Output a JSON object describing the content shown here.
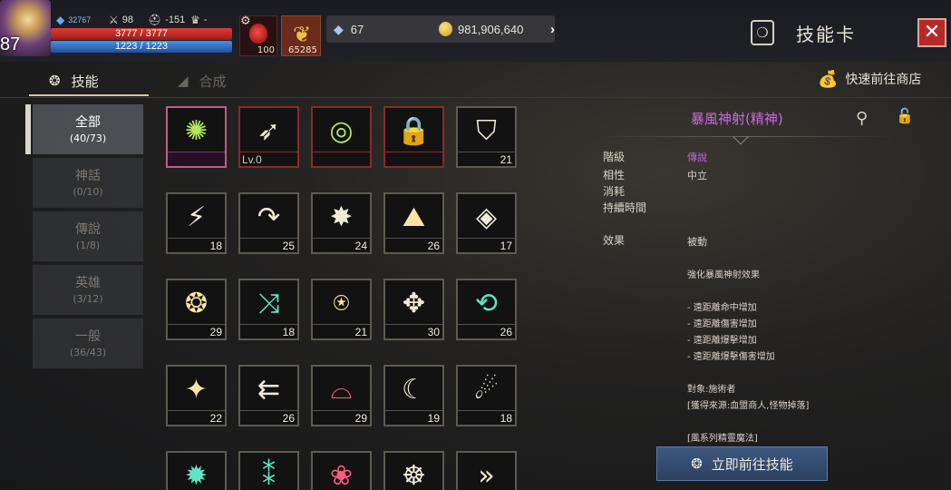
{
  "player": {
    "level": "87",
    "stats": [
      "32767",
      "98",
      "-151",
      "-"
    ],
    "hp_text": "3777 / 3777",
    "mp_text": "1223 / 1223"
  },
  "quick_items": {
    "potion_count": "100",
    "feather_count": "65285"
  },
  "currency": {
    "diamonds": "67",
    "gold": "981,906,640"
  },
  "header": {
    "panel_title": "技能卡"
  },
  "tabs": [
    {
      "label": "技能",
      "active": true
    },
    {
      "label": "合成",
      "active": false
    }
  ],
  "shop_link": "快速前往商店",
  "categories": [
    {
      "name": "全部",
      "count": "(40/73)",
      "active": true
    },
    {
      "name": "神話",
      "count": "(0/10)",
      "active": false
    },
    {
      "name": "傳說",
      "count": "(1/8)",
      "active": false
    },
    {
      "name": "英雄",
      "count": "(3/12)",
      "active": false
    },
    {
      "name": "一般",
      "count": "(36/43)",
      "active": false
    }
  ],
  "skill_grid": [
    {
      "icon": "nature-burst-icon",
      "glyph": "✺",
      "tone": "green",
      "frame": "sel",
      "level": ""
    },
    {
      "icon": "storm-arrow-icon",
      "glyph": "➶",
      "tone": "white",
      "frame": "red",
      "level": "Lv.0"
    },
    {
      "icon": "radar-tower-icon",
      "glyph": "◎",
      "tone": "green",
      "frame": "red",
      "level": ""
    },
    {
      "icon": "locked-star-icon",
      "glyph": "🔒",
      "tone": "white",
      "frame": "red",
      "level": ""
    },
    {
      "icon": "shield-crest-icon",
      "glyph": "⛉",
      "tone": "white",
      "frame": "normal",
      "level": "21"
    },
    {
      "icon": "lightning-bolt-icon",
      "glyph": "⚡",
      "tone": "white",
      "frame": "normal",
      "level": "18"
    },
    {
      "icon": "curved-arrow-icon",
      "glyph": "↷",
      "tone": "white",
      "frame": "normal",
      "level": "25"
    },
    {
      "icon": "shatter-burst-icon",
      "glyph": "✸",
      "tone": "white",
      "frame": "normal",
      "level": "24"
    },
    {
      "icon": "altar-sparkle-icon",
      "glyph": "⛰",
      "tone": "gold",
      "frame": "normal",
      "level": "26"
    },
    {
      "icon": "eagle-eye-icon",
      "glyph": "◈",
      "tone": "white",
      "frame": "normal",
      "level": "17"
    },
    {
      "icon": "thorn-wreath-icon",
      "glyph": "❂",
      "tone": "gold",
      "frame": "normal",
      "level": "29"
    },
    {
      "icon": "crossed-slash-icon",
      "glyph": "⤨",
      "tone": "teal",
      "frame": "normal",
      "level": "18"
    },
    {
      "icon": "orb-spring-icon",
      "glyph": "⍟",
      "tone": "gold",
      "frame": "normal",
      "level": "21"
    },
    {
      "icon": "blade-halo-icon",
      "glyph": "✥",
      "tone": "white",
      "frame": "normal",
      "level": "30"
    },
    {
      "icon": "cycle-arrows-icon",
      "glyph": "⟲",
      "tone": "teal",
      "frame": "normal",
      "level": "26"
    },
    {
      "icon": "splash-wave-icon",
      "glyph": "✦",
      "tone": "gold",
      "frame": "normal",
      "level": "22"
    },
    {
      "icon": "shattered-rush-icon",
      "glyph": "⇇",
      "tone": "white",
      "frame": "normal",
      "level": "26"
    },
    {
      "icon": "bat-wing-icon",
      "glyph": "⌓",
      "tone": "pink",
      "frame": "normal",
      "level": "29"
    },
    {
      "icon": "crescent-moon-icon",
      "glyph": "☾",
      "tone": "white",
      "frame": "normal",
      "level": "19"
    },
    {
      "icon": "fireball-icon",
      "glyph": "☄",
      "tone": "white",
      "frame": "normal",
      "level": "18"
    },
    {
      "icon": "teal-burst-icon",
      "glyph": "✹",
      "tone": "teal",
      "frame": "normal",
      "level": ""
    },
    {
      "icon": "pillar-sparks-icon",
      "glyph": "⁑",
      "tone": "teal",
      "frame": "normal",
      "level": ""
    },
    {
      "icon": "pink-blossom-icon",
      "glyph": "❀",
      "tone": "pink",
      "frame": "normal",
      "level": ""
    },
    {
      "icon": "web-wheel-icon",
      "glyph": "☸",
      "tone": "white",
      "frame": "normal",
      "level": ""
    },
    {
      "icon": "chevron-dash-icon",
      "glyph": "»",
      "tone": "white",
      "frame": "normal",
      "level": ""
    }
  ],
  "detail": {
    "title": "暴風神射(精神)",
    "attributes": [
      {
        "key": "階級",
        "value": "傳說",
        "purple": true
      },
      {
        "key": "相性",
        "value": "中立",
        "purple": false
      },
      {
        "key": "消耗",
        "value": "",
        "purple": false
      },
      {
        "key": "持續時間",
        "value": "",
        "purple": false
      }
    ],
    "effect_key": "效果",
    "effect_value": "被動",
    "description_lines": [
      "強化暴風神射效果",
      "- 遠距離命中增加",
      "- 遠距離傷害增加",
      "- 遠距離爆擊增加",
      "- 遠距離爆擊傷害增加",
      "對象:施術者",
      "[獲得來源:血盟商人,怪物掉落]",
      "[風系列精靈魔法]"
    ],
    "goto_button": "立即前往技能"
  },
  "colors": {
    "accent_purple": "#c86ae0",
    "close_red": "#b52a26",
    "button_blue": "#2b405e"
  }
}
